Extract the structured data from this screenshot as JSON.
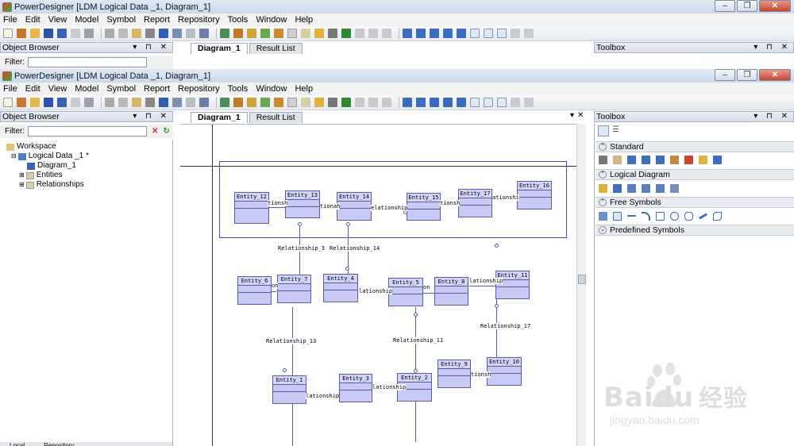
{
  "window_title": "PowerDesigner [LDM Logical Data _1, Diagram_1]",
  "menu": [
    "File",
    "Edit",
    "View",
    "Model",
    "Symbol",
    "Report",
    "Repository",
    "Tools",
    "Window",
    "Help"
  ],
  "object_browser": {
    "title": "Object Browser",
    "filter_label": "Filter:",
    "tree": {
      "workspace": "Workspace",
      "model": "Logical Data _1 *",
      "diagram": "Diagram_1",
      "entities": "Entities",
      "relationships": "Relationships"
    },
    "bottom_tabs": [
      "Local",
      "Repository"
    ]
  },
  "tabs": {
    "diagram": "Diagram_1",
    "result": "Result List"
  },
  "toolbox": {
    "title": "Toolbox",
    "sections": [
      "Standard",
      "Logical Diagram",
      "Free Symbols",
      "Predefined Symbols"
    ]
  },
  "entities": {
    "e12": "Entity_12",
    "e13": "Entity_13",
    "e14": "Entity_14",
    "e15": "Entity_15",
    "e17": "Entity_17",
    "e16": "Entity_16",
    "e6": "Entity_6",
    "e7": "Entity_7",
    "e4": "Entity_4",
    "e5": "Entity_5",
    "e8": "Entity_8",
    "e11": "Entity_11",
    "e9": "Entity_9",
    "e10": "Entity_10",
    "e1": "Entity_1",
    "e3": "Entity_3",
    "e2": "Entity_2"
  },
  "relationships": {
    "r3": "Relationship_3",
    "r14": "Relationship_14",
    "r13": "Relationship_13",
    "r11": "Relationship_11",
    "r17": "Relationship_17",
    "a": "tionsh",
    "b": "tionah",
    "c": "elationship",
    "d": "tionsh",
    "e": "ationshi",
    "f": "on",
    "g": "lationship",
    "h": "on",
    "i": "lationship",
    "j": "lationship",
    "k": "lationship",
    "l": "tionsh"
  },
  "watermark": {
    "brand": "Baidu",
    "cn": "经验",
    "url": "jingyan.baidu.com"
  }
}
